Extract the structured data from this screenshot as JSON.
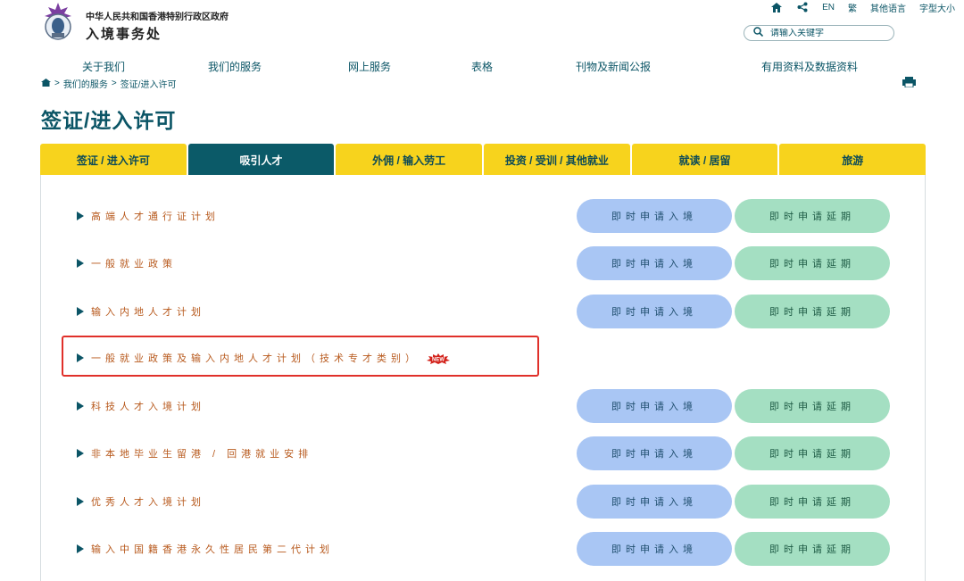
{
  "header": {
    "gov_name": "中华人民共和国香港特别行政区政府",
    "dept_name": "入境事务处"
  },
  "utility": {
    "home_icon": "home-icon",
    "share_icon": "share-icon",
    "en": "EN",
    "trad": "繁",
    "other_lang": "其他语言",
    "font_size": "字型大小"
  },
  "search": {
    "placeholder": "请输入关键字",
    "icon": "search-icon"
  },
  "nav": {
    "items": [
      "关于我们",
      "我们的服务",
      "网上服务",
      "表格",
      "刊物及新闻公报",
      "有用资料及数据资料"
    ]
  },
  "breadcrumb": {
    "sep": ">",
    "items": [
      "我们的服务",
      "签证/进入许可"
    ]
  },
  "page_title": "签证/进入许可",
  "tabs": [
    {
      "label": "签证 / 进入许可",
      "active": false
    },
    {
      "label": "吸引人才",
      "active": true
    },
    {
      "label": "外佣 / 输入劳工",
      "active": false
    },
    {
      "label": "投资 / 受训 / 其他就业",
      "active": false
    },
    {
      "label": "就读 / 居留",
      "active": false
    },
    {
      "label": "旅游",
      "active": false
    }
  ],
  "buttons": {
    "entry": "即时申请入境",
    "extend": "即时申请延期"
  },
  "schemes": [
    {
      "label": "高端人才通行证计划",
      "has_buttons": true,
      "is_new": false
    },
    {
      "label": "一般就业政策",
      "has_buttons": true,
      "is_new": false
    },
    {
      "label": "输入内地人才计划",
      "has_buttons": true,
      "is_new": false
    },
    {
      "label": "一般就业政策及输入内地人才计划（技术专才类别）",
      "has_buttons": false,
      "is_new": true,
      "badge": "NEW"
    },
    {
      "label": "科技人才入境计划",
      "has_buttons": true,
      "is_new": false
    },
    {
      "label": "非本地毕业生留港 / 回港就业安排",
      "has_buttons": true,
      "is_new": false
    },
    {
      "label": "优秀人才入境计划",
      "has_buttons": true,
      "is_new": false
    },
    {
      "label": "输入中国籍香港永久性居民第二代计划",
      "has_buttons": true,
      "is_new": false
    }
  ],
  "colors": {
    "primary": "#0b5566",
    "tab_yellow": "#f7d31d",
    "tab_active": "#0b5a68",
    "link_orange": "#b85a1e",
    "btn_blue": "#a9c6f4",
    "btn_green": "#a4dfc2",
    "highlight_red": "#e0302a"
  }
}
